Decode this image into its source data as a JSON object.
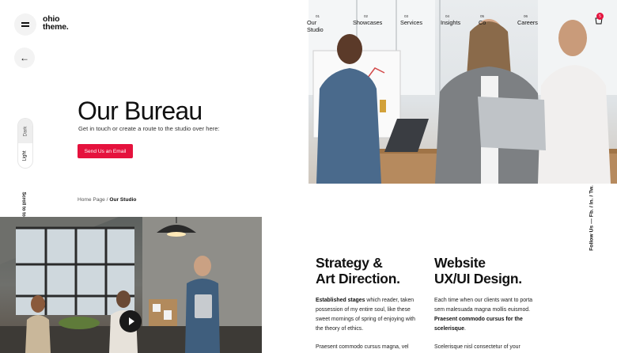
{
  "brand": {
    "logo_line1": "ohio",
    "logo_line2": "theme."
  },
  "controls": {
    "back_arrow": "←",
    "theme_dark": "Dark",
    "theme_light": "Light",
    "scroll_top": "Scroll to top"
  },
  "nav": {
    "items": [
      {
        "num": "01",
        "label": "Our Studio"
      },
      {
        "num": "02",
        "label": "Showcases"
      },
      {
        "num": "03",
        "label": "Services"
      },
      {
        "num": "04",
        "label": "Insights"
      },
      {
        "num": "05",
        "label": "Co"
      },
      {
        "num": "06",
        "label": "Careers"
      }
    ],
    "cart_count": "5"
  },
  "hero": {
    "title": "Our Bureau",
    "subtitle": "Get in touch or create a route to the studio over here:",
    "cta_label": "Send Us an Email"
  },
  "breadcrumb": {
    "home": "Home Page",
    "sep": "/",
    "current": "Our Studio"
  },
  "social": {
    "text": "Follow Us — Fb. / In. / Tw."
  },
  "services": [
    {
      "title_line1": "Strategy &",
      "title_line2": "Art Direction.",
      "p1_bold": "Established stages",
      "p1_rest": " which reader, taken possession of my entire soul, like these sweet mornings of spring of enjoying with the theory of ethics.",
      "p2": "Praesent commodo cursus magna, vel"
    },
    {
      "title_line1": "Website",
      "title_line2": "UX/UI Design.",
      "p1_text": "Each time when our clients want to porta sem malesuada magna mollis euismod. ",
      "p1_bold": "Praesent commodo cursus for the scelerisque",
      "p1_end": ".",
      "p2": "Scelerisque nisl consectetur of your"
    }
  ],
  "colors": {
    "accent": "#e5123d",
    "text": "#111111",
    "muted": "#555555"
  }
}
